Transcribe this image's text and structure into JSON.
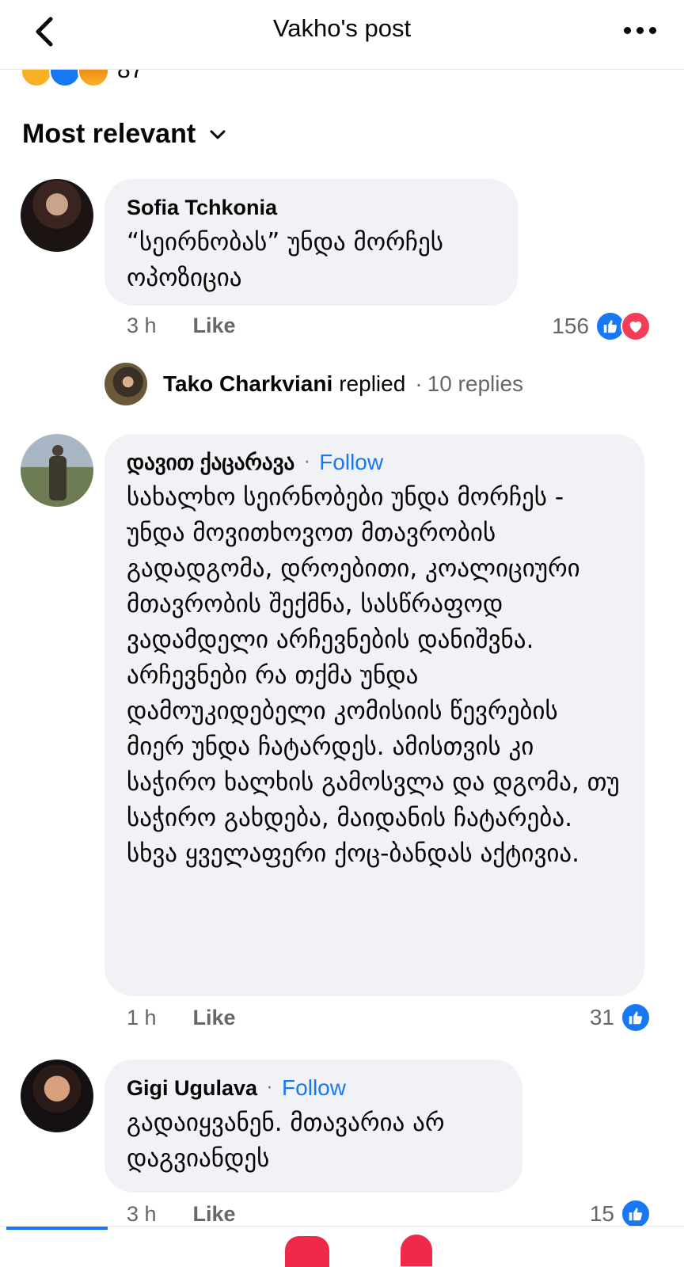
{
  "header": {
    "title": "Vakho's post",
    "back_icon": "chevron-left-icon",
    "more_icon": "more-horizontal-icon"
  },
  "post_reactions": {
    "icons": [
      "sad-reaction-icon",
      "like-reaction-icon",
      "angry-reaction-icon"
    ],
    "count": "87"
  },
  "sort": {
    "label": "Most relevant",
    "icon": "chevron-down-icon"
  },
  "comments": [
    {
      "author": "Sofia Tchkonia",
      "follow": "",
      "text": "“სეირნობას” უნდა მორჩეს ოპოზიცია",
      "time": "3 h",
      "like_label": "Like",
      "reaction_count": "156",
      "reaction_icons": [
        "like-reaction-icon",
        "love-reaction-icon"
      ]
    },
    {
      "author": "დავით ქაცარავა",
      "follow": "Follow",
      "text": "სახალხო სეირნობები უნდა მორჩეს - უნდა მოვითხოვოთ მთავრობის გადადგომა, დროებითი, კოალიციური მთავრობის შექმნა, სასწრაფოდ ვადამდელი არჩევნების დანიშვნა. არჩევნები რა თქმა უნდა დამოუკიდებელი კომისიის წევრების მიერ უნდა ჩატარდეს. ამისთვის კი საჭირო ხალხის გამოსვლა და დგომა, თუ საჭირო გახდება, მაიდანის ჩატარება. სხვა ყველაფერი ქოც-ბანდას აქტივია.",
      "time": "1 h",
      "like_label": "Like",
      "reaction_count": "31",
      "reaction_icons": [
        "like-reaction-icon"
      ]
    },
    {
      "author": "Gigi Ugulava",
      "follow": "Follow",
      "text": "გადაიყვანენ. მთავარია არ დაგვიანდეს",
      "time": "3 h",
      "like_label": "Like",
      "reaction_count": "15",
      "reaction_icons": [
        "like-reaction-icon"
      ]
    }
  ],
  "reply_preview": {
    "name": "Tako Charkviani",
    "verb": "replied",
    "separator": "·",
    "count": "10 replies"
  },
  "colors": {
    "accent": "#1877f2",
    "bubble": "#f0f2f5",
    "secondary_text": "#65676b",
    "love": "#f33e58"
  }
}
